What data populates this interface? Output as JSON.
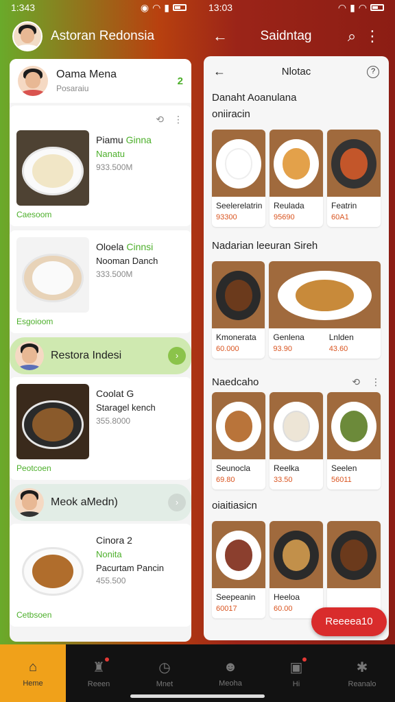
{
  "status_left": {
    "time": "1:343"
  },
  "status_right": {
    "time": "13:03"
  },
  "appbar_left": {
    "title": "Astoran Redonsia"
  },
  "appbar_right": {
    "title": "Saidntag"
  },
  "left_panel": {
    "header": {
      "name": "Oama Mena",
      "sub": "Posaraiu",
      "badge": "2"
    },
    "cards": [
      {
        "title": "Piamu",
        "tag": "Ginna",
        "line2": "Nanatu",
        "price": "933.500M",
        "footer": "Caesoom",
        "dish_color": "#f1e6c6"
      },
      {
        "title": "Oloela",
        "tag": "Cinnsi",
        "line2": "Nooman Danch",
        "price": "333.500M",
        "footer": "Esgoioom",
        "dish_color": "#f3efe6"
      }
    ],
    "section1": {
      "label": "Restora Indesi"
    },
    "card3": {
      "title": "Coolat G",
      "line2": "Staragel kench",
      "price": "355.8000",
      "footer": "Peotcoen",
      "dish_color": "#8a5a2b"
    },
    "section2": {
      "label": "Meok aMedn)"
    },
    "card4": {
      "title": "Cinora 2",
      "line2": "Nonita",
      "line3": "Pacurtam Pancin",
      "price": "455.500",
      "footer": "Cetbsoen",
      "dish_color": "#b06d2c"
    }
  },
  "right_panel": {
    "header": {
      "title": "Nlotac"
    },
    "section_a": {
      "title": "Danaht Aoanulana",
      "subtitle": "oniiracin"
    },
    "row1": [
      {
        "name": "Seelerelatrin",
        "price": "93300",
        "dish": "#ffffff"
      },
      {
        "name": "Reulada",
        "price": "95690",
        "dish": "#e3a14a"
      },
      {
        "name": "Featrin",
        "price": "60A1",
        "dish": "#c3562a"
      }
    ],
    "section_b": {
      "title": "Nadarian leeuran Sireh"
    },
    "row2": [
      {
        "name": "Kmonerata",
        "price": "60.000",
        "dish": "#6b3a1c"
      },
      {
        "name": "Genlena",
        "price": "93.90",
        "dish": "#c88a3a"
      },
      {
        "name": "Lnlden",
        "price": "43.60",
        "dish": "#d7a54e"
      }
    ],
    "section_c": {
      "title": "Naedcaho"
    },
    "row3": [
      {
        "name": "Seunocla",
        "price": "69.80",
        "dish": "#b9743a"
      },
      {
        "name": "Reelka",
        "price": "33.50",
        "dish": "#ede5d6"
      },
      {
        "name": "Seelen",
        "price": "56011",
        "dish": "#6c8a3a"
      }
    ],
    "section_d": {
      "title": "oiaitiasicn"
    },
    "row4": [
      {
        "name": "Seepeanin",
        "price": "60017",
        "dish": "#8b3f2e"
      },
      {
        "name": "Heeloa",
        "price": "60.00",
        "dish": "#c2904a"
      },
      {
        "name": "",
        "price": "",
        "dish": "#6b3a1c"
      }
    ],
    "fab_label": "Reeeea10"
  },
  "bottom_nav": [
    {
      "label": "Heme",
      "icon": "home-icon",
      "active": true
    },
    {
      "label": "Reeen",
      "icon": "chef-icon",
      "active": false
    },
    {
      "label": "Mnet",
      "icon": "clock-icon",
      "active": false
    },
    {
      "label": "Meoha",
      "icon": "person-icon",
      "active": false
    },
    {
      "label": "Hi",
      "icon": "chat-icon",
      "active": false
    },
    {
      "label": "Reanalo",
      "icon": "gear-icon",
      "active": false
    }
  ],
  "colors": {
    "accent_green": "#4caf2a",
    "accent_orange": "#f0a11a",
    "price_red": "#d9531e",
    "fab_red": "#d92c2c"
  }
}
